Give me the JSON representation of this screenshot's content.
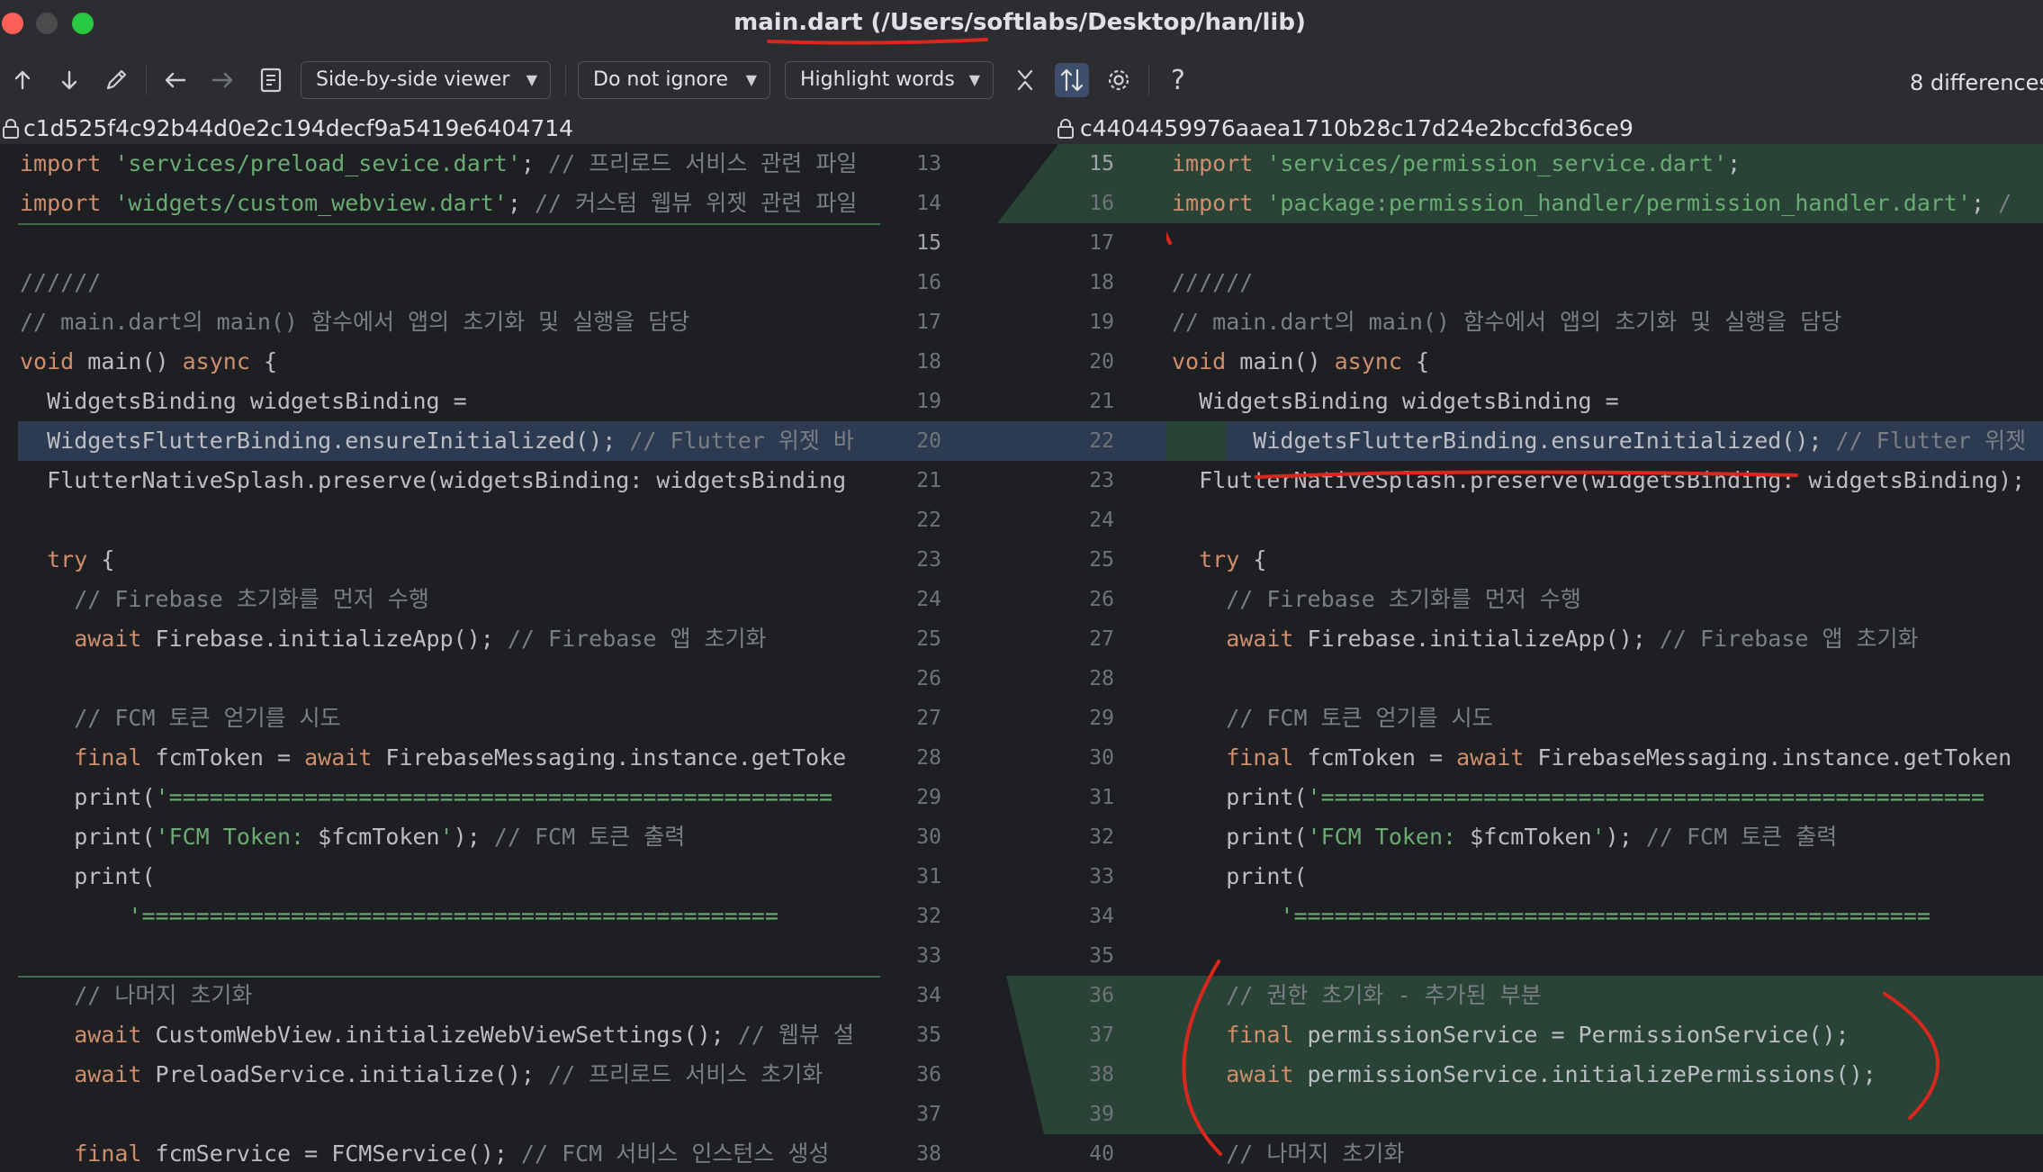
{
  "window": {
    "title": "main.dart (/Users/softlabs/Desktop/han/lib)"
  },
  "toolbar": {
    "viewer_mode": "Side-by-side viewer",
    "ignore_mode": "Do not ignore",
    "highlight_mode": "Highlight words",
    "difference_count": "8 differences",
    "icons": [
      "arrow-up-icon",
      "arrow-down-icon",
      "pencil-icon",
      "arrow-left-icon",
      "arrow-right-icon",
      "document-icon",
      "collapse-icon",
      "sync-scroll-icon",
      "gear-icon",
      "help-icon"
    ],
    "help_label": "?"
  },
  "left": {
    "hash": "c1d525f4c92b44d0e2c194decf9a5419e6404714",
    "lines": [
      "import 'services/preload_sevice.dart'; // 프리로드 서비스 관련 파일",
      "import 'widgets/custom_webview.dart'; // 커스텀 웹뷰 위젯 관련 파일",
      "",
      "//////",
      "// main.dart의 main() 함수에서 앱의 초기화 및 실행을 담당",
      "void main() async {",
      "  WidgetsBinding widgetsBinding =",
      "  WidgetsFlutterBinding.ensureInitialized(); // Flutter 위젯 바",
      "  FlutterNativeSplash.preserve(widgetsBinding: widgetsBinding",
      "",
      "  try {",
      "    // Firebase 초기화를 먼저 수행",
      "    await Firebase.initializeApp(); // Firebase 앱 초기화",
      "",
      "    // FCM 토큰 얻기를 시도",
      "    final fcmToken = await FirebaseMessaging.instance.getToke",
      "    print('=================================================",
      "    print('FCM Token: $fcmToken'); // FCM 토큰 출력",
      "    print(",
      "        '===============================================",
      "",
      "    // 나머지 초기화",
      "    await CustomWebView.initializeWebViewSettings(); // 웹뷰 설",
      "    await PreloadService.initialize(); // 프리로드 서비스 초기화",
      "",
      "    final fcmService = FCMService(); // FCM 서비스 인스턴스 생성"
    ],
    "numbers": [
      "13",
      "14",
      "15",
      "16",
      "17",
      "18",
      "19",
      "20",
      "21",
      "22",
      "23",
      "24",
      "25",
      "26",
      "27",
      "28",
      "29",
      "30",
      "31",
      "32",
      "33",
      "34",
      "35",
      "36",
      "37",
      "38"
    ]
  },
  "right": {
    "hash": "c4404459976aaea1710b28c17d24e2bccfd36ce9",
    "lines": [
      "import 'services/permission_service.dart';",
      "import 'package:permission_handler/permission_handler.dart'; /",
      "",
      "//////",
      "// main.dart의 main() 함수에서 앱의 초기화 및 실행을 담당",
      "void main() async {",
      "  WidgetsBinding widgetsBinding =",
      "      WidgetsFlutterBinding.ensureInitialized(); // Flutter 위젯",
      "  FlutterNativeSplash.preserve(widgetsBinding: widgetsBinding);",
      "",
      "  try {",
      "    // Firebase 초기화를 먼저 수행",
      "    await Firebase.initializeApp(); // Firebase 앱 초기화",
      "",
      "    // FCM 토큰 얻기를 시도",
      "    final fcmToken = await FirebaseMessaging.instance.getToken",
      "    print('=================================================",
      "    print('FCM Token: $fcmToken'); // FCM 토큰 출력",
      "    print(",
      "        '===============================================",
      "",
      "    // 권한 초기화 - 추가된 부분",
      "    final permissionService = PermissionService();",
      "    await permissionService.initializePermissions();",
      "",
      "    // 나머지 초기화"
    ],
    "numbers": [
      "15",
      "16",
      "17",
      "18",
      "19",
      "20",
      "21",
      "22",
      "23",
      "24",
      "25",
      "26",
      "27",
      "28",
      "29",
      "30",
      "31",
      "32",
      "33",
      "34",
      "35",
      "36",
      "37",
      "38",
      "39",
      "40"
    ]
  },
  "colors": {
    "added": "#294436",
    "modified": "#2d3b52",
    "annotation": "#d9271e"
  }
}
